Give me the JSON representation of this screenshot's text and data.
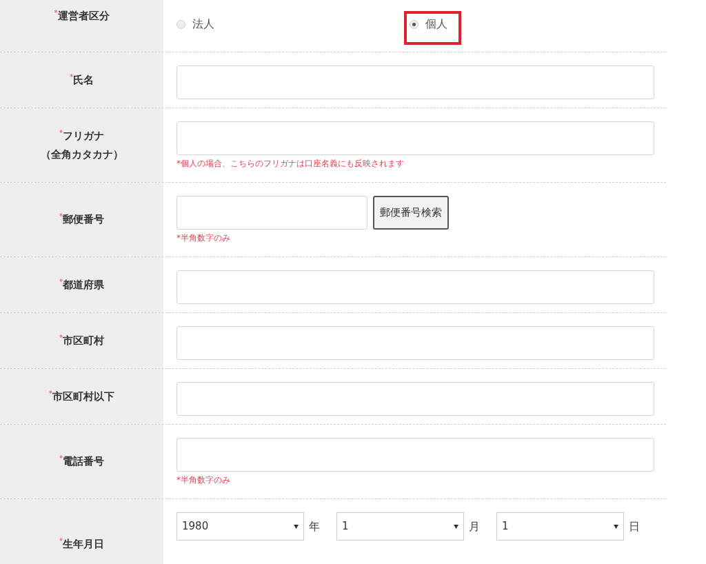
{
  "rows": [
    {
      "mark": "*",
      "label": "運営者区分",
      "kind": "radio",
      "options": [
        {
          "label": "法人",
          "selected": false,
          "highlighted": false
        },
        {
          "label": "個人",
          "selected": true,
          "highlighted": true
        }
      ]
    },
    {
      "mark": "*",
      "label": "氏名",
      "kind": "text"
    },
    {
      "mark": "*",
      "label": "フリガナ",
      "sublabel": "（全角カタカナ）",
      "kind": "text",
      "note": "*個人の場合、こちらのフリガナは口座名義にも反映されます"
    },
    {
      "mark": "*",
      "label": "郵便番号",
      "kind": "postal",
      "button": "郵便番号検索",
      "note": "*半角数字のみ"
    },
    {
      "mark": "*",
      "label": "都道府県",
      "kind": "text"
    },
    {
      "mark": "*",
      "label": "市区町村",
      "kind": "text"
    },
    {
      "mark": "*",
      "label": "市区町村以下",
      "kind": "text"
    },
    {
      "mark": "*",
      "label": "電話番号",
      "kind": "text",
      "note": "*半角数字のみ"
    },
    {
      "mark": "*",
      "label": "生年月日",
      "kind": "date",
      "selects": [
        {
          "value": "1980",
          "unit": "年"
        },
        {
          "value": "1",
          "unit": "月"
        },
        {
          "value": "1",
          "unit": "日"
        }
      ]
    }
  ]
}
